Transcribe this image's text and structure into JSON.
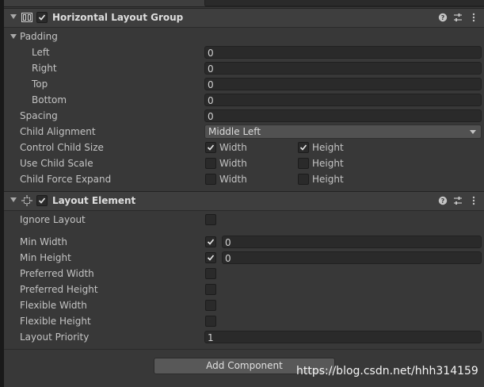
{
  "top_strip": {
    "text": "……"
  },
  "horizontal_layout_group": {
    "title": "Horizontal Layout Group",
    "enabled": true,
    "padding": {
      "label": "Padding",
      "left": {
        "label": "Left",
        "value": "0"
      },
      "right": {
        "label": "Right",
        "value": "0"
      },
      "top": {
        "label": "Top",
        "value": "0"
      },
      "bottom": {
        "label": "Bottom",
        "value": "0"
      }
    },
    "spacing": {
      "label": "Spacing",
      "value": "0"
    },
    "child_alignment": {
      "label": "Child Alignment",
      "value": "Middle Left"
    },
    "control_child_size": {
      "label": "Control Child Size",
      "width_label": "Width",
      "width_checked": true,
      "height_label": "Height",
      "height_checked": true
    },
    "use_child_scale": {
      "label": "Use Child Scale",
      "width_label": "Width",
      "width_checked": false,
      "height_label": "Height",
      "height_checked": false
    },
    "child_force_expand": {
      "label": "Child Force Expand",
      "width_label": "Width",
      "width_checked": false,
      "height_label": "Height",
      "height_checked": false
    }
  },
  "layout_element": {
    "title": "Layout Element",
    "enabled": true,
    "ignore_layout": {
      "label": "Ignore Layout",
      "checked": false
    },
    "min_width": {
      "label": "Min Width",
      "checked": true,
      "value": "0"
    },
    "min_height": {
      "label": "Min Height",
      "checked": true,
      "value": "0"
    },
    "preferred_width": {
      "label": "Preferred Width",
      "checked": false
    },
    "preferred_height": {
      "label": "Preferred Height",
      "checked": false
    },
    "flexible_width": {
      "label": "Flexible Width",
      "checked": false
    },
    "flexible_height": {
      "label": "Flexible Height",
      "checked": false
    },
    "layout_priority": {
      "label": "Layout Priority",
      "value": "1"
    }
  },
  "add_component_label": "Add Component",
  "watermark": "https://blog.csdn.net/hhh314159",
  "colors": {
    "background": "#383838",
    "header": "#3e3e3e",
    "field": "#2a2a2a",
    "text": "#c4c4c4"
  },
  "icons": [
    "foldout-arrow-icon",
    "horizontal-layout-icon",
    "layout-element-icon",
    "check-icon",
    "help-icon",
    "preset-icon",
    "kebab-menu-icon",
    "dropdown-arrow-icon"
  ]
}
